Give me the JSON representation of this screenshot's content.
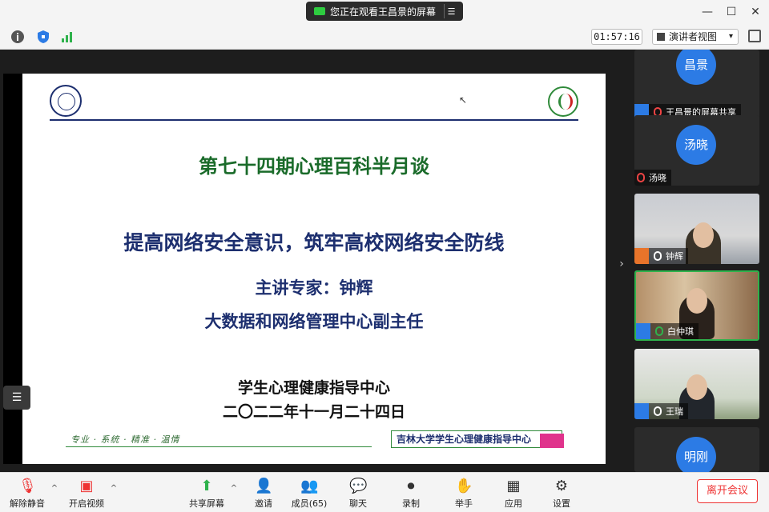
{
  "window": {
    "viewing_label": "您正在观看王昌景的屏幕",
    "minimize": "—",
    "maximize": "☐",
    "close": "✕"
  },
  "toolbar": {
    "timer": "01:57:16",
    "view_mode": "演讲者视图",
    "view_mode_caret": "▾"
  },
  "slide": {
    "title": "第七十四期心理百科半月谈",
    "subtitle": "提高网络安全意识，筑牢高校网络安全防线",
    "speaker_line": "主讲专家：钟辉",
    "position_line": "大数据和网络管理中心副主任",
    "org_line": "学生心理健康指导中心",
    "date_line": "二〇二二年十一月二十四日",
    "footer_motto": "专业 · 系统 · 精准 · 温情",
    "footer_banner": "吉林大学学生心理健康指导中心"
  },
  "participants": [
    {
      "avatar": "昌景",
      "name": "王昌景的屏幕共享"
    },
    {
      "avatar": "汤晓",
      "name": "汤晓"
    },
    {
      "name": "钟辉"
    },
    {
      "name": "白仲琪"
    },
    {
      "name": "王瑞"
    },
    {
      "avatar": "明刚"
    }
  ],
  "controls": {
    "unmute": "解除静音",
    "start_video": "开启视频",
    "share_screen": "共享屏幕",
    "invite": "邀请",
    "members": "成员(65)",
    "chat": "聊天",
    "record": "录制",
    "raise_hand": "举手",
    "apps": "应用",
    "settings": "设置",
    "leave": "离开会议"
  },
  "icons": {
    "info": "info-icon",
    "shield": "shield-icon",
    "signal": "signal-icon",
    "fullscreen": "fullscreen-icon"
  },
  "colors": {
    "accent_blue": "#2c7be5",
    "active_green": "#2fb24c",
    "leave_red": "#e33333",
    "slide_title_green": "#1a6b2a",
    "slide_text_navy": "#1d2f6f"
  }
}
